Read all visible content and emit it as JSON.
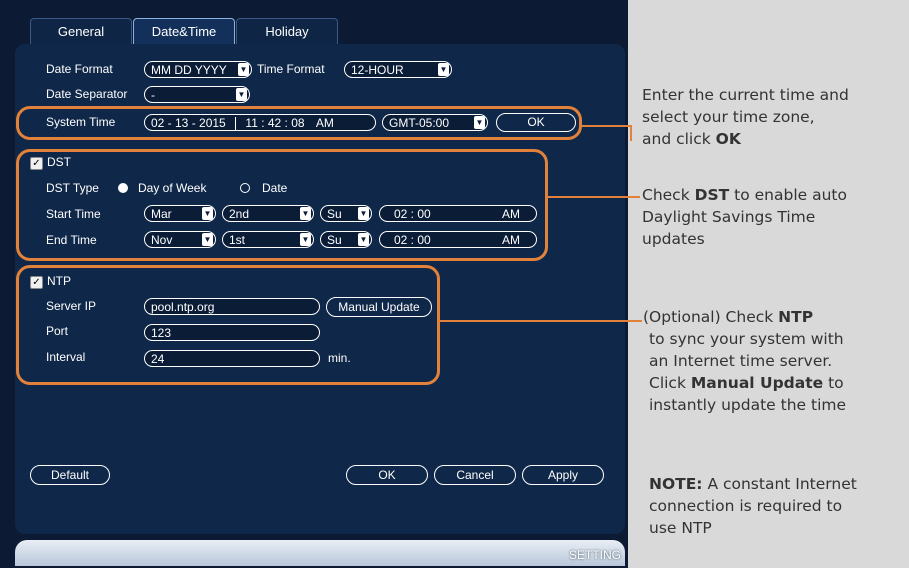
{
  "tabs": [
    {
      "label": "General"
    },
    {
      "label": "Date&Time"
    },
    {
      "label": "Holiday"
    }
  ],
  "date_format": {
    "label": "Date Format",
    "value": "MM DD YYYY"
  },
  "time_format": {
    "label": "Time Format",
    "value": "12-HOUR"
  },
  "date_separator": {
    "label": "Date Separator",
    "value": "-"
  },
  "system_time": {
    "label": "System Time",
    "date": "02 - 13 - 2015",
    "time": "11 : 42 : 08",
    "ampm": "AM",
    "timezone": "GMT-05:00",
    "ok": "OK"
  },
  "dst": {
    "label": "DST",
    "checked": true,
    "type_label": "DST Type",
    "opt_day": "Day of Week",
    "opt_date": "Date",
    "start": {
      "label": "Start Time",
      "month": "Mar",
      "week": "2nd",
      "day": "Su",
      "time": "02 : 00",
      "ampm": "AM"
    },
    "end": {
      "label": "End Time",
      "month": "Nov",
      "week": "1st",
      "day": "Su",
      "time": "02 : 00",
      "ampm": "AM"
    }
  },
  "ntp": {
    "label": "NTP",
    "checked": true,
    "server_label": "Server IP",
    "server": "pool.ntp.org",
    "manual": "Manual Update",
    "port_label": "Port",
    "port": "123",
    "interval_label": "Interval",
    "interval": "24",
    "interval_unit": "min."
  },
  "buttons": {
    "default": "Default",
    "ok": "OK",
    "cancel": "Cancel",
    "apply": "Apply"
  },
  "footer": "SETTING",
  "annotations": {
    "a1": {
      "l1": "Enter the current time and",
      "l2": "select your time zone,",
      "l3a": "and click ",
      "l3b": "OK"
    },
    "a2": {
      "l1a": "Check ",
      "l1b": "DST",
      "l1c": " to enable auto",
      "l2": "Daylight Savings Time",
      "l3": "updates"
    },
    "a3": {
      "l1a": "(Optional) Check ",
      "l1b": "NTP",
      "l2": "to sync your system with",
      "l3": "an Internet time server.",
      "l4a": "Click ",
      "l4b": "Manual Update",
      "l4c": " to",
      "l5": "instantly update the time"
    },
    "a4": {
      "l1a": "NOTE:",
      "l1b": " A constant Internet",
      "l2": "connection is required to",
      "l3": "use NTP"
    }
  },
  "colors": {
    "highlight": "#e2823a",
    "panel": "#0f2748",
    "background": "#0c1b33"
  }
}
